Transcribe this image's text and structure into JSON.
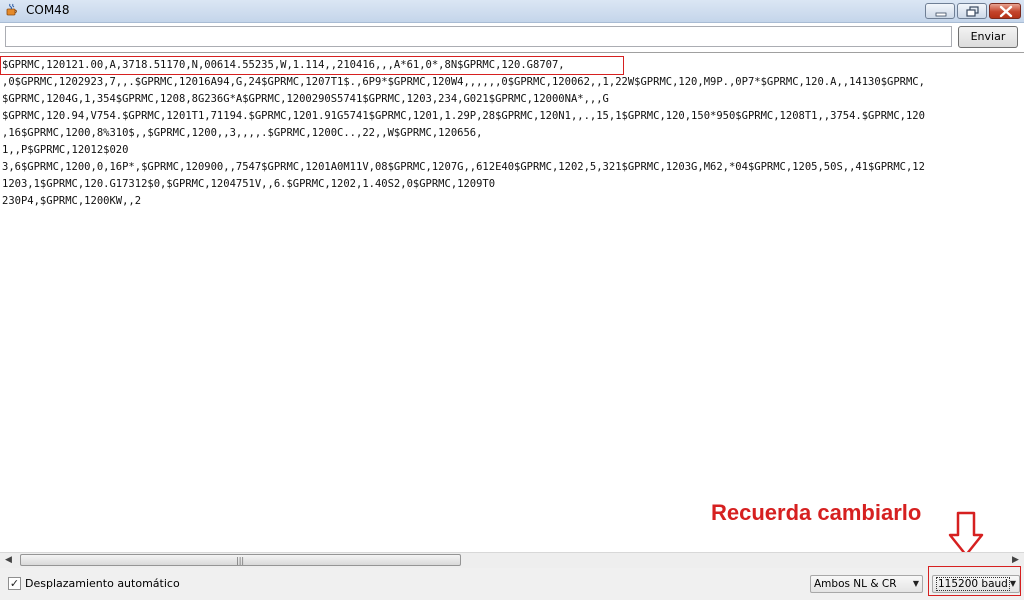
{
  "window": {
    "title": "COM48",
    "icon": "java-cup-icon",
    "controls": [
      "minimize-icon",
      "maximize-icon",
      "close-icon"
    ]
  },
  "send": {
    "input_value": "",
    "button_label": "Enviar"
  },
  "output": {
    "lines": [
      "$GPRMC,120121.00,A,3718.51170,N,00614.55235,W,1.114,,210416,,,A*61,0*,8N$GPRMC,120.G8707,",
      ",0$GPRMC,1202923,7,,.$GPRMC,12016A94,G,24$GPRMC,1207T1$.,6P9*$GPRMC,120W4,,,,,,0$GPRMC,120062,,1,22W$GPRMC,120,M9P.,0P7*$GPRMC,120.A,,14130$GPRMC,",
      "$GPRMC,1204G,1,354$GPRMC,1208,8G236G*A$GPRMC,1200290S5741$GPRMC,1203,234,G021$GPRMC,12000NA*,,,G",
      "$GPRMC,120.94,V754.$GPRMC,1201T1,71194.$GPRMC,1201.91G5741$GPRMC,1201,1.29P,28$GPRMC,120N1,,.,15,1$GPRMC,120,150*950$GPRMC,1208T1,,3754.$GPRMC,120",
      ",16$GPRMC,1200,8%310$,,$GPRMC,1200,,3,,,,.$GPRMC,1200C..,22,,W$GPRMC,120656,",
      "1,,P$GPRMC,12012$020",
      "3,6$GPRMC,1200,0,16P*,$GPRMC,120900,,7547$GPRMC,1201A0M11V,08$GPRMC,1207G,,612E40$GPRMC,1202,5,321$GPRMC,1203G,M62,*04$GPRMC,1205,50S,,41$GPRMC,12",
      "1203,1$GPRMC,120.G17312$0,$GPRMC,1204751V,,6.$GPRMC,1202,1.40S2,0$GPRMC,1209T0",
      "230P4,$GPRMC,1200KW,,2"
    ]
  },
  "scrollbar": {
    "orientation": "horizontal",
    "icons": [
      "scroll-left-icon",
      "scroll-right-icon"
    ]
  },
  "footer": {
    "autoscroll_label": "Desplazamiento automático",
    "autoscroll_checked": true,
    "line_ending_selected": "Ambos NL & CR",
    "baud_selected": "115200 baud"
  },
  "annotation": {
    "text": "Recuerda cambiarlo",
    "color": "#d62020",
    "icon": "down-arrow-icon"
  },
  "colors": {
    "annotation_red": "#d62020",
    "titlebar": "#c4d5ea",
    "close_button": "#c4442b"
  }
}
